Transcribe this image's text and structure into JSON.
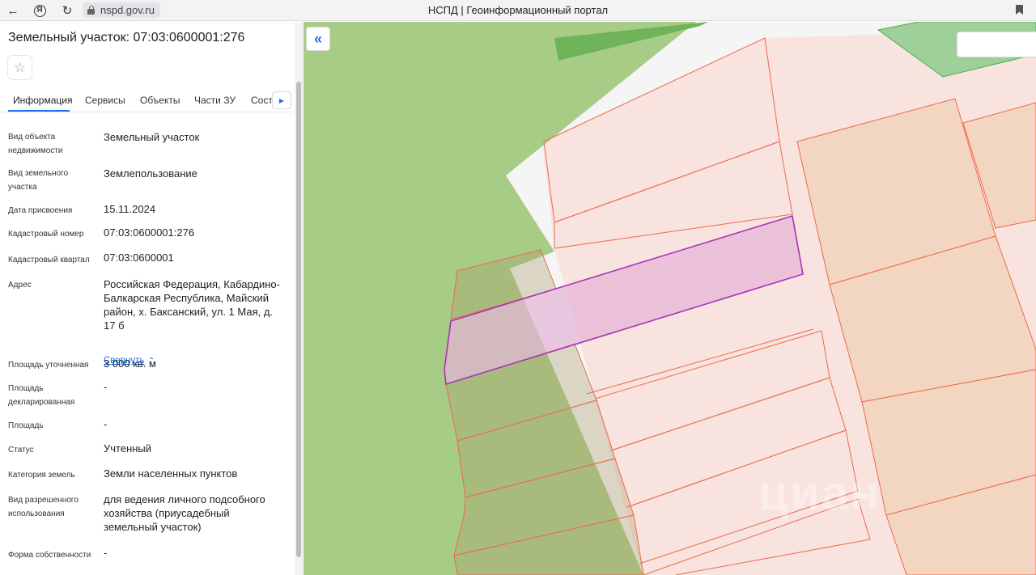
{
  "browser": {
    "url": "nspd.gov.ru",
    "tab_title": "НСПД | Геоинформационный портал",
    "ya_glyph": "Я"
  },
  "sidebar": {
    "title": "Земельный участок: 07:03:0600001:276",
    "tabs": [
      "Информация",
      "Сервисы",
      "Объекты",
      "Части ЗУ",
      "Соста"
    ],
    "properties": [
      {
        "label": "Вид объекта недвижимости",
        "value": "Земельный участок"
      },
      {
        "label": "Вид земельного участка",
        "value": "Землепользование"
      },
      {
        "label": "Дата присвоения",
        "value": "15.11.2024"
      },
      {
        "label": "Кадастровый номер",
        "value": "07:03:0600001:276"
      },
      {
        "label": "Кадастровый квартал",
        "value": "07:03:0600001"
      },
      {
        "label": "Адрес",
        "value": "Российская Федерация, Кабардино-Балкарская Республика, Майский район, х. Баксанский, ул. 1 Мая, д. 17 б"
      },
      {
        "label": "Площадь уточненная",
        "value": "3 000 кв. м"
      },
      {
        "label": "Площадь декларированная",
        "value": "-"
      },
      {
        "label": "Площадь",
        "value": "-"
      },
      {
        "label": "Статус",
        "value": "Учтенный"
      },
      {
        "label": "Категория земель",
        "value": "Земли населенных пунктов"
      },
      {
        "label": "Вид разрешенного использования",
        "value": "для ведения личного подсобного хозяйства (приусадебный земельный участок)"
      },
      {
        "label": "Форма собственности",
        "value": "-"
      }
    ],
    "collapse_label": "Свернуть"
  },
  "map": {
    "watermark": "циан",
    "colors": {
      "green_zone": "#a7cc85",
      "parcel_fill": "#f8e3df",
      "parcel_border": "#ec6a4a",
      "selected_fill": "#e4b2d6",
      "selected_border": "#a832b8",
      "road": "#eeefdc",
      "tan_zone": "#f2dcc4"
    }
  }
}
